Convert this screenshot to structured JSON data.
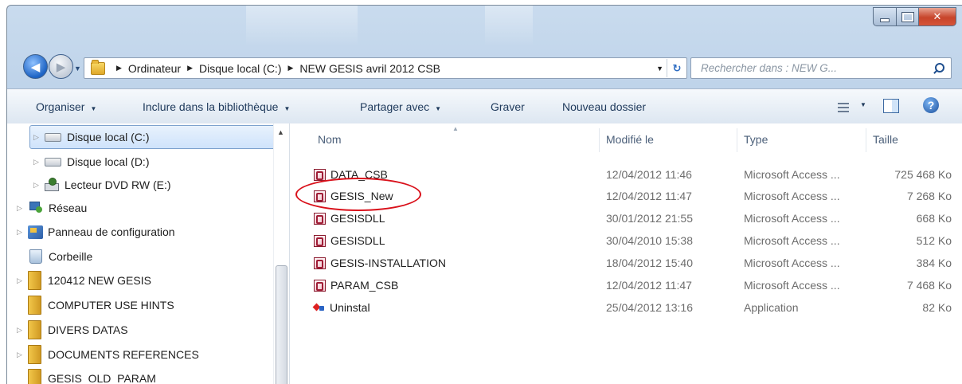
{
  "address": {
    "crumbs": [
      "Ordinateur",
      "Disque local (C:)",
      "NEW GESIS avril 2012 CSB"
    ]
  },
  "search": {
    "placeholder": "Rechercher dans : NEW G..."
  },
  "toolbar": {
    "organize": "Organiser",
    "library": "Inclure dans la bibliothèque",
    "share": "Partager avec",
    "burn": "Graver",
    "new_folder": "Nouveau dossier"
  },
  "nav": {
    "items": [
      {
        "label": "Disque local (C:)",
        "icon": "drive-icon"
      },
      {
        "label": "Disque local (D:)",
        "icon": "drive-icon"
      },
      {
        "label": "Lecteur DVD RW (E:)",
        "icon": "dvd-drive-icon"
      },
      {
        "label": "Réseau",
        "icon": "network-icon"
      },
      {
        "label": "Panneau de configuration",
        "icon": "control-panel-icon"
      },
      {
        "label": "Corbeille",
        "icon": "recycle-bin-icon"
      },
      {
        "label": "120412 NEW GESIS",
        "icon": "folder-icon"
      },
      {
        "label": "COMPUTER USE HINTS",
        "icon": "folder-icon"
      },
      {
        "label": "DIVERS DATAS",
        "icon": "folder-icon"
      },
      {
        "label": "DOCUMENTS REFERENCES",
        "icon": "folder-icon"
      },
      {
        "label": "GESIS_OLD_PARAM",
        "icon": "folder-icon"
      }
    ]
  },
  "columns": {
    "name": "Nom",
    "modified": "Modifié le",
    "type": "Type",
    "size": "Taille"
  },
  "files": [
    {
      "name": "DATA_CSB",
      "modified": "12/04/2012 11:46",
      "type": "Microsoft Access ...",
      "size": "725 468 Ko",
      "icon": "access-db-icon"
    },
    {
      "name": "GESIS_New",
      "modified": "12/04/2012 11:47",
      "type": "Microsoft Access ...",
      "size": "7 268 Ko",
      "icon": "access-db-icon"
    },
    {
      "name": "GESISDLL",
      "modified": "30/01/2012 21:55",
      "type": "Microsoft Access ...",
      "size": "668 Ko",
      "icon": "access-db-icon"
    },
    {
      "name": "GESISDLL",
      "modified": "30/04/2010 15:38",
      "type": "Microsoft Access ...",
      "size": "512 Ko",
      "icon": "access-db-icon"
    },
    {
      "name": "GESIS-INSTALLATION",
      "modified": "18/04/2012 15:40",
      "type": "Microsoft Access ...",
      "size": "384 Ko",
      "icon": "access-db-icon"
    },
    {
      "name": "PARAM_CSB",
      "modified": "12/04/2012 11:47",
      "type": "Microsoft Access ...",
      "size": "7 468 Ko",
      "icon": "access-db-icon"
    },
    {
      "name": "Uninstal",
      "modified": "25/04/2012 13:16",
      "type": "Application",
      "size": "82 Ko",
      "icon": "application-icon"
    }
  ],
  "colors": {
    "annotation": "#d9101a",
    "selection": "#cfe3fb"
  }
}
